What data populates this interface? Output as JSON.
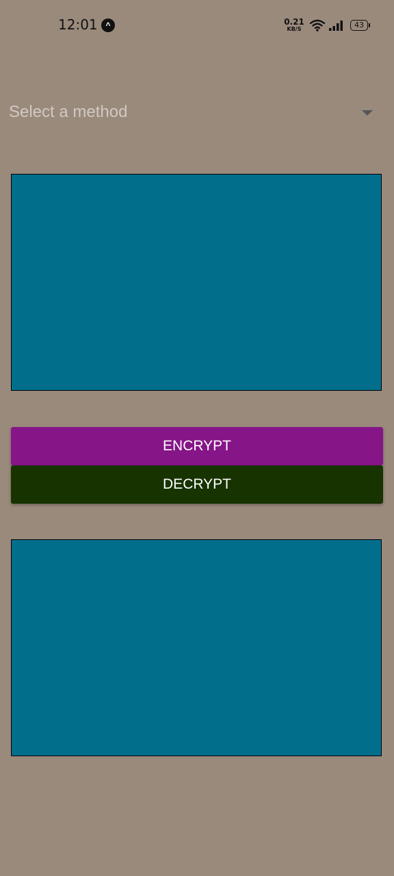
{
  "status_bar": {
    "time": "12:01",
    "app_badge": "^",
    "net_speed_value": "0.21",
    "net_speed_unit": "KB/S",
    "battery": "43",
    "icons": [
      "app-notification-icon",
      "wifi-icon",
      "signal-icon",
      "battery-icon"
    ]
  },
  "method_select": {
    "placeholder": "Select a method",
    "icon": "chevron-down-icon"
  },
  "input_box": {
    "value": ""
  },
  "buttons": {
    "encrypt": "ENCRYPT",
    "decrypt": "DECRYPT"
  },
  "output_box": {
    "value": ""
  },
  "colors": {
    "background": "#9a8a7c",
    "text_box": "#016e8c",
    "encrypt_button": "#861588",
    "decrypt_button": "#163300",
    "placeholder_text": "#d2c9c1"
  }
}
